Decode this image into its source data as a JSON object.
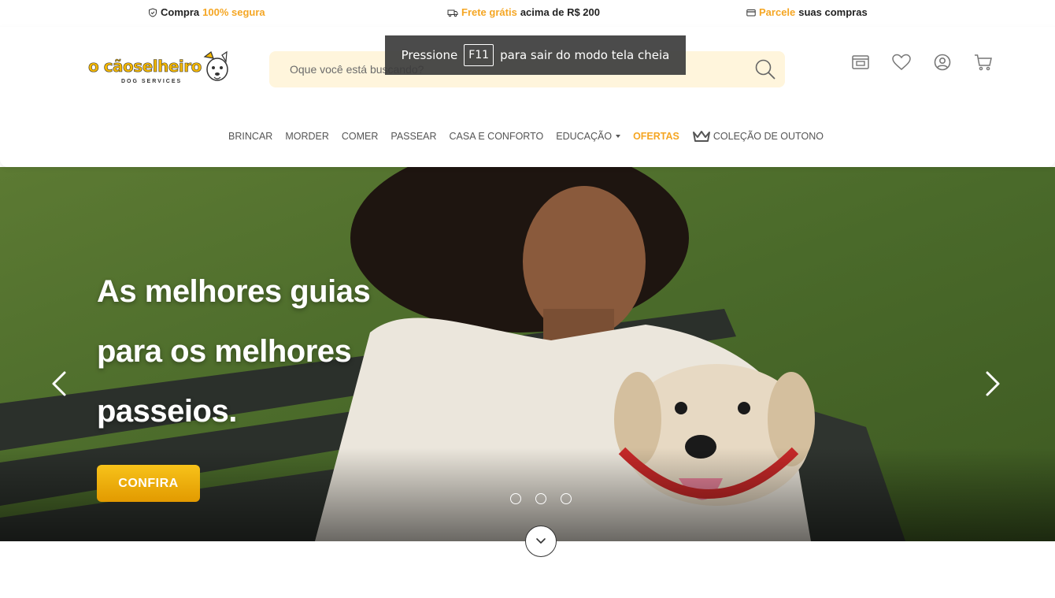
{
  "topbar": {
    "secure": {
      "pre": "Compra",
      "hl": "100% segura",
      "post": ""
    },
    "shipping": {
      "pre": "",
      "hl": "Frete grátis",
      "post": "acima de R$ 200"
    },
    "installments": {
      "pre": "",
      "hl": "Parcele",
      "post": "suas compras"
    }
  },
  "logo": {
    "wordmark": "o cãoselheiro",
    "subtitle": "DOG SERVICES"
  },
  "search": {
    "placeholder": "Oque você está buscando?"
  },
  "header_icons": [
    "store-icon",
    "heart-icon",
    "user-icon",
    "cart-icon"
  ],
  "nav": {
    "items": [
      "BRINCAR",
      "MORDER",
      "COMER",
      "PASSEAR",
      "CASA E CONFORTO",
      "EDUCAÇÃO",
      "OFERTAS",
      "COLEÇÃO DE OUTONO"
    ]
  },
  "toast": {
    "pre": "Pressione",
    "key": "F11",
    "post": "para sair do modo tela cheia"
  },
  "hero": {
    "headline": [
      "As melhores guias",
      "para os melhores",
      "passeios."
    ],
    "cta": "CONFIRA",
    "slides": 3,
    "active_slide": 1
  },
  "colors": {
    "accent": "#f5a623",
    "search_bg": "#fff5dc",
    "cta_top": "#f7c21a",
    "cta_bottom": "#e29a00"
  }
}
